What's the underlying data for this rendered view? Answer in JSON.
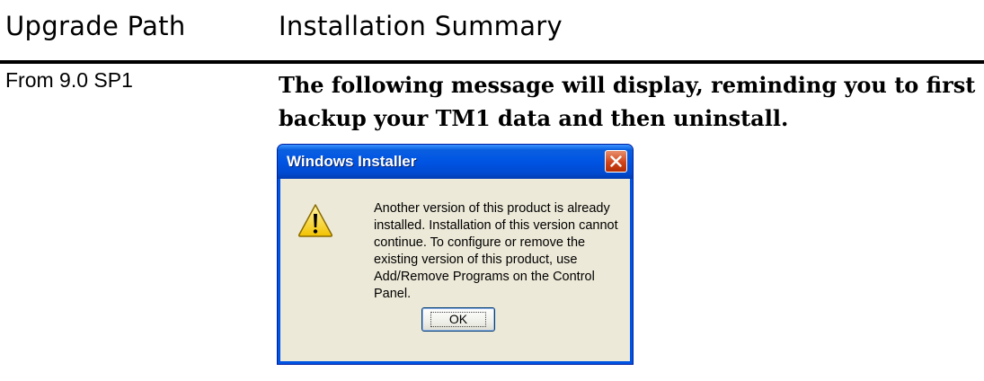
{
  "table": {
    "headers": [
      "Upgrade Path",
      "Installation Summary"
    ],
    "row": {
      "path": "From 9.0 SP1",
      "summary": "The following message will display, reminding you to first backup your TM1 data and then uninstall."
    }
  },
  "dialog": {
    "title": "Windows Installer",
    "message": "Another version of this product is already installed. Installation of this version cannot continue. To configure or remove the existing version of this product, use Add/Remove Programs on the Control Panel.",
    "ok_label": "OK",
    "icons": {
      "warning": "warning-icon",
      "close": "close-icon"
    }
  }
}
